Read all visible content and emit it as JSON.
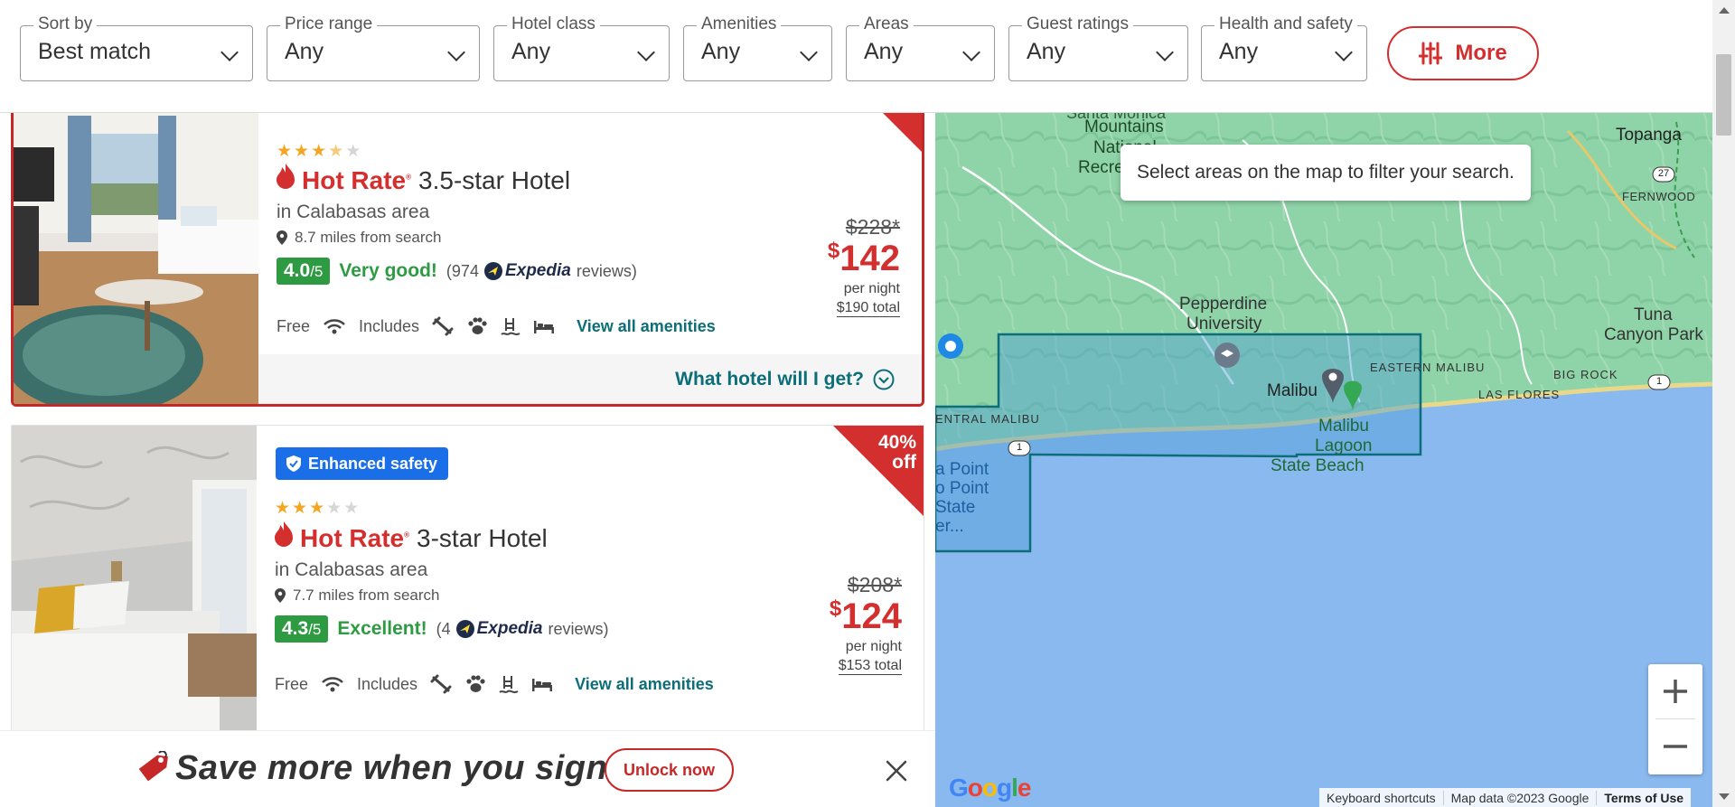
{
  "filters": [
    {
      "label": "Sort by",
      "value": "Best match"
    },
    {
      "label": "Price range",
      "value": "Any"
    },
    {
      "label": "Hotel class",
      "value": "Any"
    },
    {
      "label": "Amenities",
      "value": "Any"
    },
    {
      "label": "Areas",
      "value": "Any"
    },
    {
      "label": "Guest ratings",
      "value": "Any"
    },
    {
      "label": "Health and safety",
      "value": "Any"
    }
  ],
  "more_label": "More",
  "hotels": [
    {
      "badge": "",
      "star_rating": 3.5,
      "hot_rate": "Hot Rate",
      "title": "3.5-star Hotel",
      "area": "in Calabasas area",
      "distance": "8.7 miles from search",
      "score": "4.0",
      "score_max": "/5",
      "rating_word": "Very good!",
      "reviews_prefix": "(974",
      "reviews_brand": "Expedia",
      "reviews_suffix": "reviews)",
      "free_label": "Free",
      "includes_label": "Includes",
      "amenities_link": "View all amenities",
      "old_price": "$228*",
      "currency": "$",
      "price": "142",
      "per_night": "per night",
      "total": "$190 total",
      "what_hotel": "What hotel will I get?"
    },
    {
      "badge": "Enhanced safety",
      "star_rating": 3,
      "hot_rate": "Hot Rate",
      "title": "3-star Hotel",
      "area": "in Calabasas area",
      "distance": "7.7 miles from search",
      "score": "4.3",
      "score_max": "/5",
      "rating_word": "Excellent!",
      "reviews_prefix": "(4",
      "reviews_brand": "Expedia",
      "reviews_suffix": "reviews)",
      "free_label": "Free",
      "includes_label": "Includes",
      "amenities_link": "View all amenities",
      "old_price": "$208*",
      "currency": "$",
      "price": "124",
      "per_night": "per night",
      "total": "$153 total",
      "discount_1": "40%",
      "discount_2": "off"
    }
  ],
  "banner": {
    "message": "Save more when you sign in!",
    "button": "Unlock now"
  },
  "map": {
    "hint": "Select areas on the map to filter your search.",
    "labels": {
      "mountains": "Mountains",
      "national": "National",
      "recre": "Recre",
      "santa_monica": "Santa Monica",
      "topanga": "Topanga",
      "fernwood": "FERNWOOD",
      "pepperdine1": "Pepperdine",
      "pepperdine2": "University",
      "tuna1": "Tuna",
      "tuna2": "Canyon Park",
      "eastern_malibu": "EASTERN MALIBU",
      "big_rock": "BIG ROCK",
      "las_flores": "LAS FLORES",
      "malibu": "Malibu",
      "lagoon1": "Malibu",
      "lagoon2": "Lagoon",
      "lagoon3": "State Beach",
      "central_malibu": "ENTRAL MALIBU",
      "point1": "a Point",
      "point2": "o Point",
      "point3": "State",
      "point4": "er...",
      "route27": "27",
      "route1a": "1",
      "route1b": "1"
    },
    "google": "Google",
    "attribution": [
      "Keyboard shortcuts",
      "Map data ©2023 Google",
      "Terms of Use"
    ]
  },
  "colors": {
    "accent_red": "#d32f2f",
    "rating_green": "#2e9b43",
    "link_teal": "#0b6e79",
    "badge_blue": "#1a6ee8",
    "water_blue": "#8ab9ef",
    "land_green": "#8fd3a8"
  }
}
